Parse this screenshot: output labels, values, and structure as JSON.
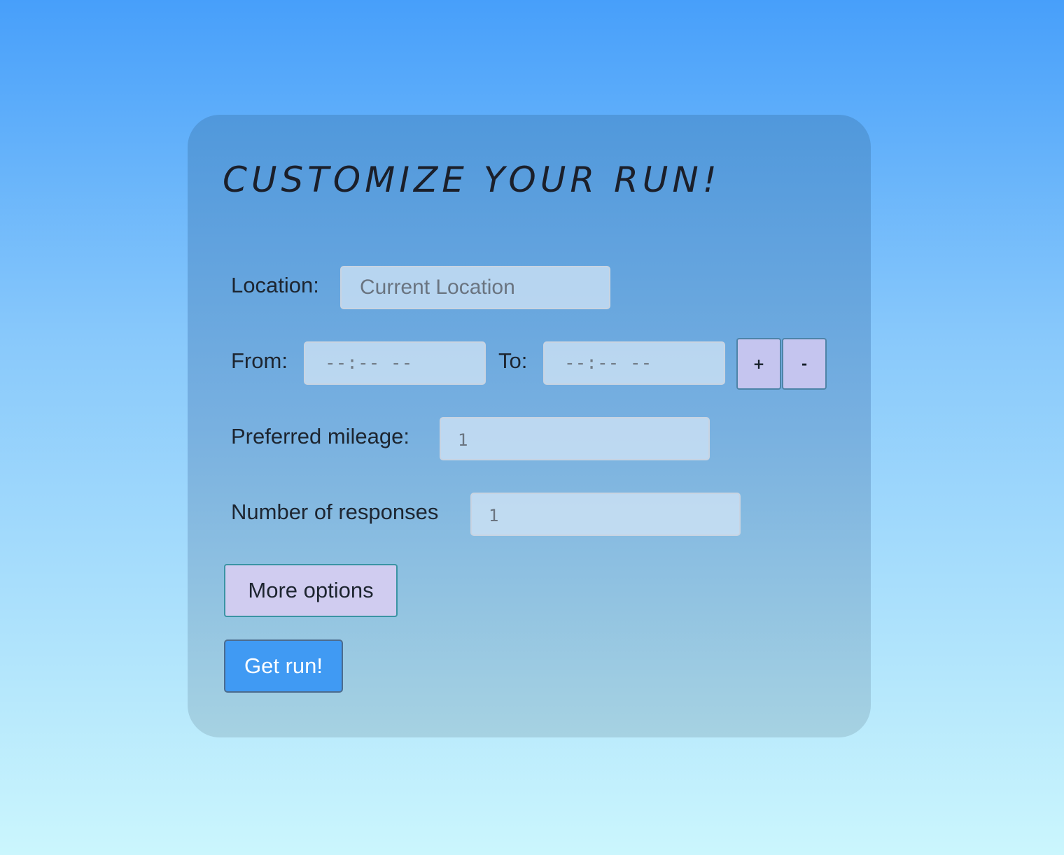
{
  "form": {
    "title": "CUSTOMIZE YOUR RUN!",
    "location": {
      "label": "Location:",
      "placeholder": "Current Location"
    },
    "time_range": {
      "from_label": "From:",
      "from_value": "--:-- --",
      "to_label": "To:",
      "to_value": "--:-- --",
      "add_label": "+",
      "remove_label": "-"
    },
    "mileage": {
      "label": "Preferred mileage:",
      "value": "1"
    },
    "responses": {
      "label": "Number of responses",
      "value": "1"
    },
    "more_options_label": "More options",
    "submit_label": "Get run!"
  },
  "colors": {
    "background_top": "#479ffa",
    "background_bottom": "#cbf6fd",
    "card_top": "#5098dc",
    "card_bottom": "#a6d2e2",
    "secondary_button": "#d0ccf0",
    "primary_button": "#409af3",
    "stepper_button": "#c5c5ef"
  }
}
